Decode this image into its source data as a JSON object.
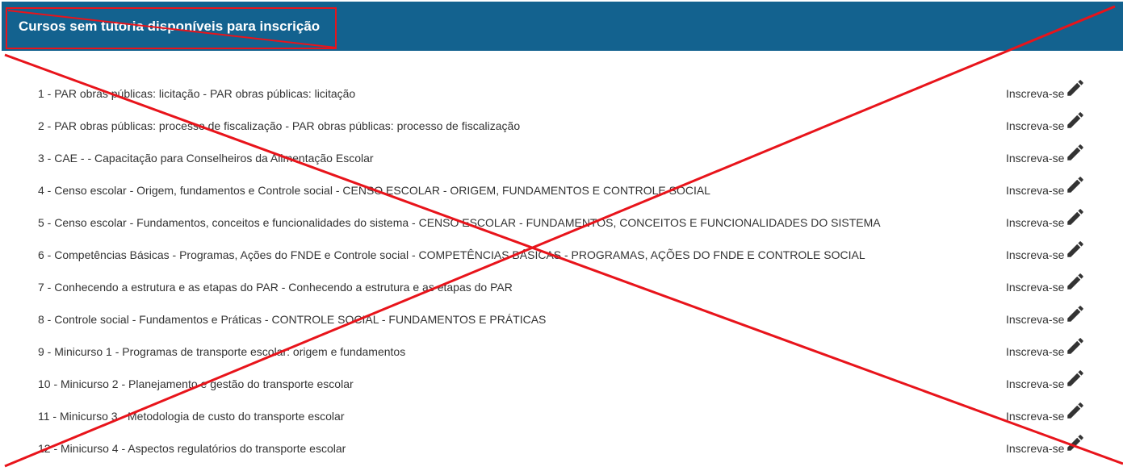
{
  "header": {
    "title": "Cursos sem tutoria disponíveis para inscrição"
  },
  "courses": [
    {
      "text": "1 - PAR obras públicas: licitação - PAR obras públicas: licitação",
      "action": "Inscreva-se"
    },
    {
      "text": "2 - PAR obras públicas: processo de fiscalização - PAR obras públicas: processo de fiscalização",
      "action": "Inscreva-se"
    },
    {
      "text": "3 - CAE - - Capacitação para Conselheiros da Alimentação Escolar",
      "action": "Inscreva-se"
    },
    {
      "text": "4 - Censo escolar - Origem, fundamentos e Controle social - CENSO ESCOLAR - ORIGEM, FUNDAMENTOS E CONTROLE SOCIAL",
      "action": "Inscreva-se"
    },
    {
      "text": "5 - Censo escolar - Fundamentos, conceitos e funcionalidades do sistema - CENSO ESCOLAR - FUNDAMENTOS, CONCEITOS E FUNCIONALIDADES DO SISTEMA",
      "action": "Inscreva-se"
    },
    {
      "text": "6 - Competências Básicas - Programas, Ações do FNDE e Controle social - COMPETÊNCIAS BÁSICAS - PROGRAMAS, AÇÕES DO FNDE E CONTROLE SOCIAL",
      "action": "Inscreva-se"
    },
    {
      "text": "7 - Conhecendo a estrutura e as etapas do PAR - Conhecendo a estrutura e as etapas do PAR",
      "action": "Inscreva-se"
    },
    {
      "text": "8 - Controle social - Fundamentos e Práticas - CONTROLE SOCIAL - FUNDAMENTOS E PRÁTICAS",
      "action": "Inscreva-se"
    },
    {
      "text": "9 - Minicurso 1 - Programas de transporte escolar: origem e fundamentos",
      "action": "Inscreva-se"
    },
    {
      "text": "10 - Minicurso 2 - Planejamento e gestão do transporte escolar",
      "action": "Inscreva-se"
    },
    {
      "text": "11 - Minicurso 3 - Metodologia de custo do transporte escolar",
      "action": "Inscreva-se"
    },
    {
      "text": "12 - Minicurso 4 - Aspectos regulatórios do transporte escolar",
      "action": "Inscreva-se"
    }
  ],
  "colors": {
    "header_bg": "#13628f",
    "annotation_red": "#e8141b",
    "text": "#333333",
    "icon": "#333333"
  },
  "icons": {
    "enroll": "pencil-icon"
  }
}
